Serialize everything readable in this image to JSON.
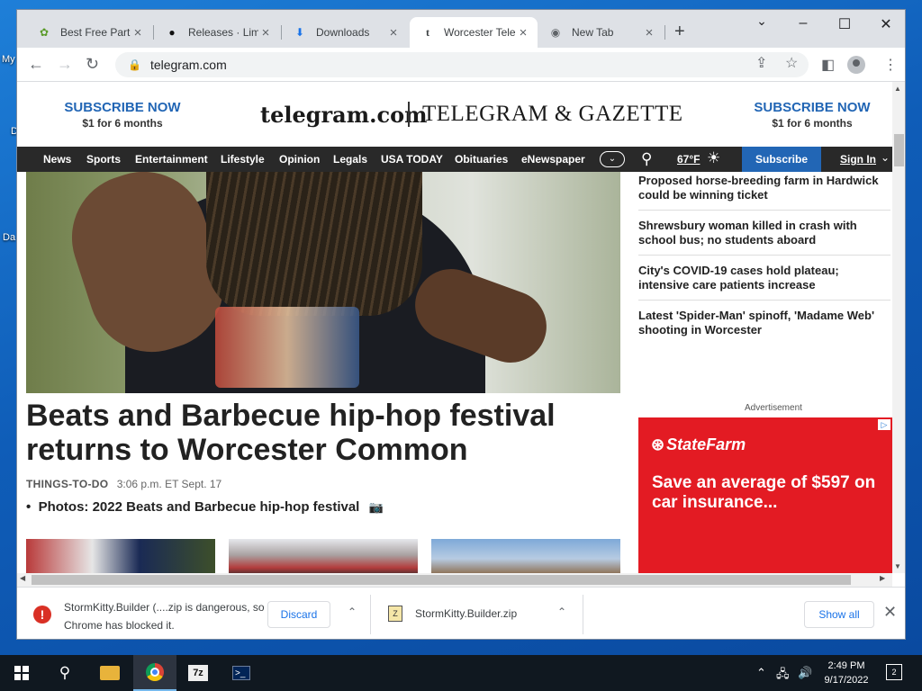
{
  "desktop": {
    "labels": [
      "My",
      "D",
      "Da"
    ]
  },
  "browser": {
    "tabs": [
      {
        "title": "Best Free Partiti",
        "icon": "site-favicon"
      },
      {
        "title": "Releases · Lime",
        "icon": "github-icon"
      },
      {
        "title": "Downloads",
        "icon": "download-icon"
      },
      {
        "title": "Worcester Teleg",
        "icon": "telegram-favicon",
        "active": true
      },
      {
        "title": "New Tab",
        "icon": "chrome-icon"
      }
    ],
    "url": "telegram.com"
  },
  "site": {
    "subscribe_left": {
      "title": "SUBSCRIBE NOW",
      "price": "$1 for 6 months"
    },
    "subscribe_right": {
      "title": "SUBSCRIBE NOW",
      "price": "$1 for 6 months"
    },
    "logo_left": "telegram.com",
    "logo_right": "TELEGRAM & GAZETTE",
    "nav": [
      "News",
      "Sports",
      "Entertainment",
      "Lifestyle",
      "Opinion",
      "Legals",
      "USA TODAY",
      "Obituaries",
      "eNewspaper"
    ],
    "weather": "67°F",
    "subscribe_button": "Subscribe",
    "signin": "Sign In",
    "headline": "Beats and Barbecue hip-hop festival returns to Worcester Common",
    "section": "THINGS-TO-DO",
    "timestamp": "3:06 p.m. ET Sept. 17",
    "related": "Photos: 2022 Beats and Barbecue hip-hop festival",
    "sidebar": [
      "Proposed horse-breeding farm in Hardwick could be winning ticket",
      "Shrewsbury woman killed in crash with school bus; no students aboard",
      "City's COVID-19 cases hold plateau; intensive care patients increase",
      "Latest 'Spider-Man' spinoff, 'Madame Web' shooting in Worcester"
    ],
    "ad_label": "Advertisement",
    "ad": {
      "brand": "StateFarm",
      "text": "Save an average of $597 on car insurance..."
    }
  },
  "downloads": {
    "blocked_text": "StormKitty.Builder (....zip is dangerous, so Chrome has blocked it.",
    "discard": "Discard",
    "file": "StormKitty.Builder.zip",
    "show_all": "Show all"
  },
  "taskbar": {
    "time": "2:49 PM",
    "date": "9/17/2022",
    "notifications": "2"
  },
  "colors": {
    "accent": "#2266b5",
    "navbar": "#292929",
    "ad": "#e31b23"
  }
}
